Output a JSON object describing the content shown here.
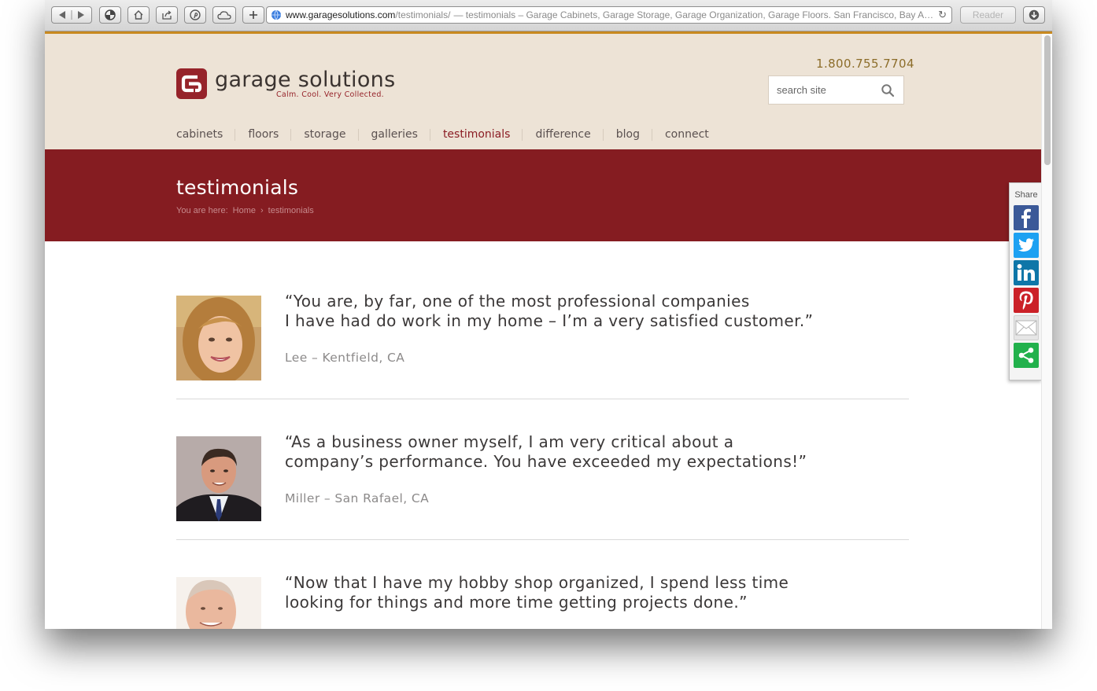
{
  "browser": {
    "url_host": "www.garagesolutions.com",
    "url_path": "/testimonials/",
    "page_title": "— testimonials – Garage Cabinets, Garage Storage, Garage Organization, Garage Floors. San Francisco, Bay Are…",
    "reader_label": "Reader"
  },
  "header": {
    "logo_name": "garage solutions",
    "logo_tagline": "Calm. Cool. Very Collected.",
    "phone": "1.800.755.7704",
    "search_placeholder": "search site"
  },
  "nav": {
    "items": [
      {
        "label": "cabinets"
      },
      {
        "label": "floors"
      },
      {
        "label": "storage"
      },
      {
        "label": "galleries"
      },
      {
        "label": "testimonials"
      },
      {
        "label": "difference"
      },
      {
        "label": "blog"
      },
      {
        "label": "connect"
      }
    ]
  },
  "banner": {
    "title": "testimonials",
    "crumb_prefix": "You are here:",
    "crumb_home": "Home",
    "crumb_current": "testimonials"
  },
  "testimonials": [
    {
      "line1": "“You are, by far, one of the most professional companies",
      "line2": "I have had do work in my home – I’m a very satisfied customer.”",
      "author": "Lee – Kentfield, CA"
    },
    {
      "line1": "“As a business owner myself, I am very critical about a",
      "line2": "company’s performance. You have exceeded my expectations!”",
      "author": "Miller – San Rafael, CA"
    },
    {
      "line1": "“Now that I have my hobby shop organized, I spend less time",
      "line2": "looking for things and more time getting projects done.”",
      "author": ""
    }
  ],
  "share": {
    "label": "Share",
    "buttons": [
      {
        "icon": "facebook-icon",
        "color": "#3b5998"
      },
      {
        "icon": "twitter-icon",
        "color": "#1da1f2"
      },
      {
        "icon": "linkedin-icon",
        "color": "#0e76a8"
      },
      {
        "icon": "pinterest-icon",
        "color": "#cb2027"
      },
      {
        "icon": "email-icon",
        "color": "#e6e6e6"
      },
      {
        "icon": "share-icon",
        "color": "#22b14c"
      }
    ]
  },
  "colors": {
    "brand_red": "#851c21",
    "header_bg": "#ede3d6",
    "active_nav": "#8b1d24",
    "phone": "#8c6d2a"
  }
}
